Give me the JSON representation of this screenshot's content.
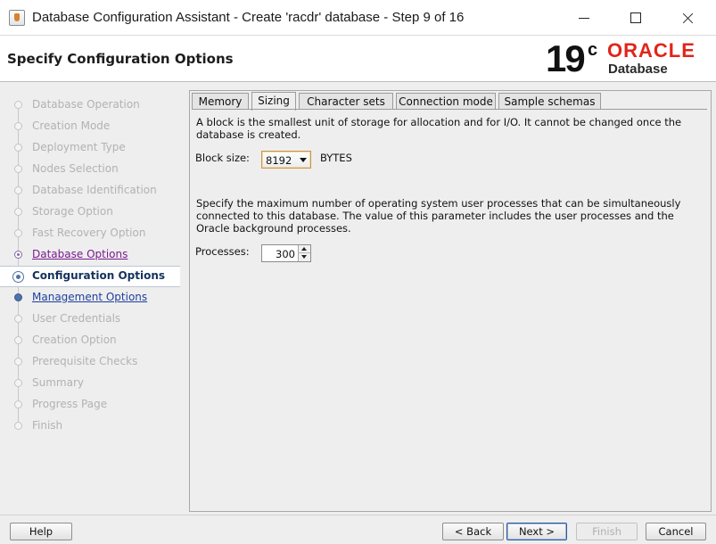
{
  "window": {
    "title": "Database Configuration Assistant - Create 'racdr' database - Step 9 of 16",
    "controls": {
      "minimize": "minimize-icon",
      "maximize": "maximize-icon",
      "close": "close-icon"
    }
  },
  "header": {
    "page_title": "Specify Configuration Options",
    "version_number": "19",
    "version_suffix": "c",
    "brand": "ORACLE",
    "product": "Database",
    "brand_color": "#e0251b"
  },
  "steps": [
    {
      "label": "Database Operation",
      "state": "disabled"
    },
    {
      "label": "Creation Mode",
      "state": "disabled"
    },
    {
      "label": "Deployment Type",
      "state": "disabled"
    },
    {
      "label": "Nodes Selection",
      "state": "disabled"
    },
    {
      "label": "Database Identification",
      "state": "disabled"
    },
    {
      "label": "Storage Option",
      "state": "disabled"
    },
    {
      "label": "Fast Recovery Option",
      "state": "disabled"
    },
    {
      "label": "Database Options",
      "state": "visited"
    },
    {
      "label": "Configuration Options",
      "state": "current"
    },
    {
      "label": "Management Options",
      "state": "next"
    },
    {
      "label": "User Credentials",
      "state": "disabled"
    },
    {
      "label": "Creation Option",
      "state": "disabled"
    },
    {
      "label": "Prerequisite Checks",
      "state": "disabled"
    },
    {
      "label": "Summary",
      "state": "disabled"
    },
    {
      "label": "Progress Page",
      "state": "disabled"
    },
    {
      "label": "Finish",
      "state": "disabled"
    }
  ],
  "tabs": [
    {
      "label": "Memory",
      "active": false
    },
    {
      "label": "Sizing",
      "active": true
    },
    {
      "label": "Character sets",
      "active": false
    },
    {
      "label": "Connection mode",
      "active": false
    },
    {
      "label": "Sample schemas",
      "active": false
    }
  ],
  "sizing": {
    "block_description": "A block is the smallest unit of storage for allocation and for I/O. It cannot be changed once the database is created.",
    "block_size_label": "Block size:",
    "block_size_value": "8192",
    "block_size_unit": "BYTES",
    "processes_description": "Specify the maximum number of operating system user processes that can be simultaneously connected to this database. The value of this parameter includes the user processes and the Oracle background processes.",
    "processes_label": "Processes:",
    "processes_value": "300"
  },
  "footer": {
    "help": "Help",
    "back": "< Back",
    "next": "Next >",
    "finish": "Finish",
    "cancel": "Cancel"
  }
}
